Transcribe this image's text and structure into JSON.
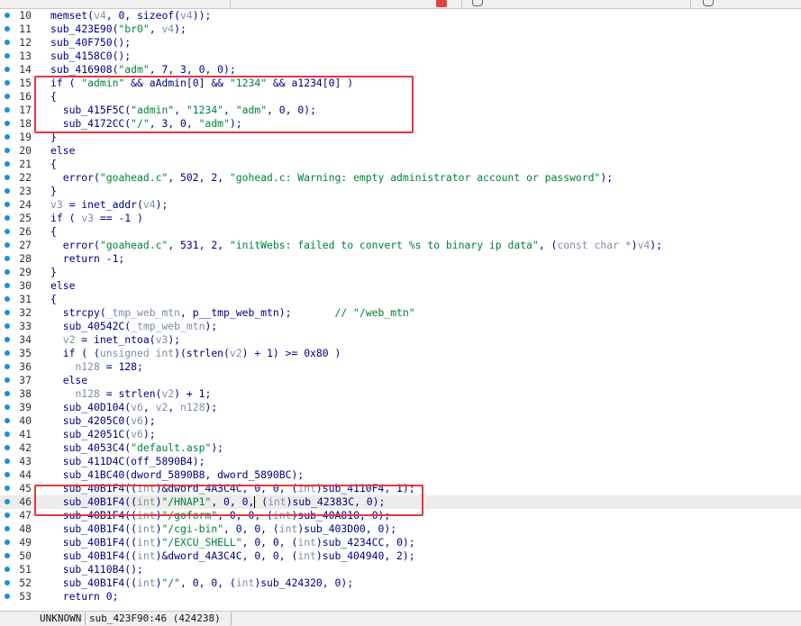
{
  "status": {
    "mode": "UNKNOWN",
    "location": "sub_423F90:46 (424238)"
  },
  "code_lines": [
    {
      "n": "10",
      "hl": false,
      "html": "memset(<span class=\"var\">v4</span>, 0, sizeof(<span class=\"var\">v4</span>));"
    },
    {
      "n": "11",
      "hl": false,
      "html": "sub_423E90(<span class=\"str\">\"br0\"</span>, <span class=\"var\">v4</span>);"
    },
    {
      "n": "12",
      "hl": false,
      "html": "sub_40F750();"
    },
    {
      "n": "13",
      "hl": false,
      "html": "sub_4158C0();"
    },
    {
      "n": "14",
      "hl": false,
      "html": "sub_416908(<span class=\"str\">\"adm\"</span>, 7, 3, 0, 0);"
    },
    {
      "n": "15",
      "hl": false,
      "html": "if ( <span class=\"str\">\"admin\"</span> &amp;&amp; aAdmin[0] &amp;&amp; <span class=\"str\">\"1234\"</span> &amp;&amp; a1234[0] )"
    },
    {
      "n": "16",
      "hl": false,
      "html": "{"
    },
    {
      "n": "17",
      "hl": false,
      "html": "  sub_415F5C(<span class=\"str\">\"admin\"</span>, <span class=\"str\">\"1234\"</span>, <span class=\"str\">\"adm\"</span>, 0, 0);"
    },
    {
      "n": "18",
      "hl": false,
      "html": "  sub_4172CC(<span class=\"str\">\"/\"</span>, 3, 0, <span class=\"str\">\"adm\"</span>);"
    },
    {
      "n": "19",
      "hl": false,
      "html": "}"
    },
    {
      "n": "20",
      "hl": false,
      "html": "else"
    },
    {
      "n": "21",
      "hl": false,
      "html": "{"
    },
    {
      "n": "22",
      "hl": false,
      "html": "  error(<span class=\"str\">\"goahead.c\"</span>, 502, 2, <span class=\"str\">\"gohead.c: Warning: empty administrator account or password\"</span>);"
    },
    {
      "n": "23",
      "hl": false,
      "html": "}"
    },
    {
      "n": "24",
      "hl": false,
      "html": "<span class=\"var\">v3</span> = inet_addr(<span class=\"var\">v4</span>);"
    },
    {
      "n": "25",
      "hl": false,
      "html": "if ( <span class=\"var\">v3</span> == -1 )"
    },
    {
      "n": "26",
      "hl": false,
      "html": "{"
    },
    {
      "n": "27",
      "hl": false,
      "html": "  error(<span class=\"str\">\"goahead.c\"</span>, 531, 2, <span class=\"str\">\"initWebs: failed to convert %s to binary ip data\"</span>, (<span class=\"var\">const char *</span>)<span class=\"var\">v4</span>);"
    },
    {
      "n": "28",
      "hl": false,
      "html": "  return -1;"
    },
    {
      "n": "29",
      "hl": false,
      "html": "}"
    },
    {
      "n": "30",
      "hl": false,
      "html": "else"
    },
    {
      "n": "31",
      "hl": false,
      "html": "{"
    },
    {
      "n": "32",
      "hl": false,
      "html": "  strcpy(<span class=\"var\">_tmp_web_mtn</span>, p__tmp_web_mtn);       <span class=\"cmt\">// \"/web_mtn\"</span>"
    },
    {
      "n": "33",
      "hl": false,
      "html": "  sub_40542C(<span class=\"var\">_tmp_web_mtn</span>);"
    },
    {
      "n": "34",
      "hl": false,
      "html": "  <span class=\"var\">v2</span> = inet_ntoa(<span class=\"var\">v3</span>);"
    },
    {
      "n": "35",
      "hl": false,
      "html": "  if ( (<span class=\"var\">unsigned int</span>)(strlen(<span class=\"var\">v2</span>) + 1) &gt;= 0x80 )"
    },
    {
      "n": "36",
      "hl": false,
      "html": "    <span class=\"var\">n128</span> = 128;"
    },
    {
      "n": "37",
      "hl": false,
      "html": "  else"
    },
    {
      "n": "38",
      "hl": false,
      "html": "    <span class=\"var\">n128</span> = strlen(<span class=\"var\">v2</span>) + 1;"
    },
    {
      "n": "39",
      "hl": false,
      "html": "  sub_40D104(<span class=\"var\">v6</span>, <span class=\"var\">v2</span>, <span class=\"var\">n128</span>);"
    },
    {
      "n": "40",
      "hl": false,
      "html": "  sub_4205C0(<span class=\"var\">v6</span>);"
    },
    {
      "n": "41",
      "hl": false,
      "html": "  sub_42051C(<span class=\"var\">v6</span>);"
    },
    {
      "n": "42",
      "hl": false,
      "html": "  sub_4053C4(<span class=\"str\">\"default.asp\"</span>);"
    },
    {
      "n": "43",
      "hl": false,
      "html": "  sub_411D4C(off_5890B4);"
    },
    {
      "n": "44",
      "hl": false,
      "html": "  sub_41BC40(dword_5890B8, dword_5890BC);"
    },
    {
      "n": "45",
      "hl": false,
      "html": "  sub_40B1F4((<span class=\"var\">int</span>)&amp;dword_4A3C4C, 0, 0, (<span class=\"var\">int</span>)sub_4110F4, 1);"
    },
    {
      "n": "46",
      "hl": true,
      "html": "  sub_40B1F4((<span class=\"var\">int</span>)<span class=\"str\">\"/HNAP1\"</span>, 0, 0,<span class=\"cursor\"></span> (<span class=\"var\">int</span>)sub_42383C, 0);"
    },
    {
      "n": "47",
      "hl": false,
      "html": "  sub_40B1F4((<span class=\"var\">int</span>)<span class=\"str\">\"/goform\"</span>, 0, 0, (<span class=\"var\">int</span>)sub_40A810, 0);"
    },
    {
      "n": "48",
      "hl": false,
      "html": "  sub_40B1F4((<span class=\"var\">int</span>)<span class=\"str\">\"/cgi-bin\"</span>, 0, 0, (<span class=\"var\">int</span>)sub_403D00, 0);"
    },
    {
      "n": "49",
      "hl": false,
      "html": "  sub_40B1F4((<span class=\"var\">int</span>)<span class=\"str\">\"/EXCU_SHELL\"</span>, 0, 0, (<span class=\"var\">int</span>)sub_4234CC, 0);"
    },
    {
      "n": "50",
      "hl": false,
      "html": "  sub_40B1F4((<span class=\"var\">int</span>)&amp;dword_4A3C4C, 0, 0, (<span class=\"var\">int</span>)sub_404940, 2);"
    },
    {
      "n": "51",
      "hl": false,
      "html": "  sub_4110B4();"
    },
    {
      "n": "52",
      "hl": false,
      "html": "  sub_40B1F4((<span class=\"var\">int</span>)<span class=\"str\">\"/\"</span>, 0, 0, (<span class=\"var\">int</span>)sub_424320, 0);"
    },
    {
      "n": "53",
      "hl": false,
      "html": "  return 0;"
    }
  ]
}
